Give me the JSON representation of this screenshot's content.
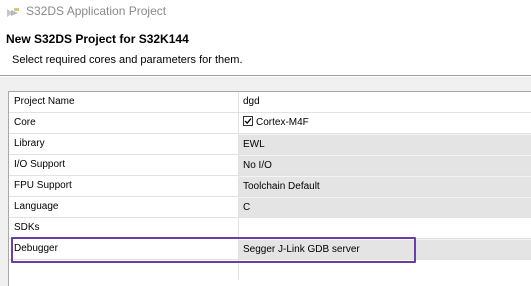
{
  "window": {
    "title": "S32DS Application Project",
    "icon": "s32ds-app-icon"
  },
  "wizard": {
    "title": "New S32DS Project for S32K144",
    "description": "Select required cores and parameters for them."
  },
  "properties": [
    {
      "label": "Project Name",
      "value": "dgd",
      "disabled": false
    },
    {
      "label": "Core",
      "value": "Cortex-M4F",
      "checkbox": true,
      "checked": true,
      "disabled": false
    },
    {
      "label": "Library",
      "value": "EWL",
      "disabled": true
    },
    {
      "label": "I/O Support",
      "value": "No I/O",
      "disabled": true
    },
    {
      "label": "FPU Support",
      "value": "Toolchain Default",
      "disabled": true
    },
    {
      "label": "Language",
      "value": "C",
      "disabled": true
    },
    {
      "label": "SDKs",
      "value": "",
      "disabled": false
    },
    {
      "label": "Debugger",
      "value": "Segger J-Link GDB server",
      "disabled": true
    }
  ],
  "colors": {
    "highlight_border": "#6a3fa3",
    "disabled_cell": "#e4e4e4"
  }
}
